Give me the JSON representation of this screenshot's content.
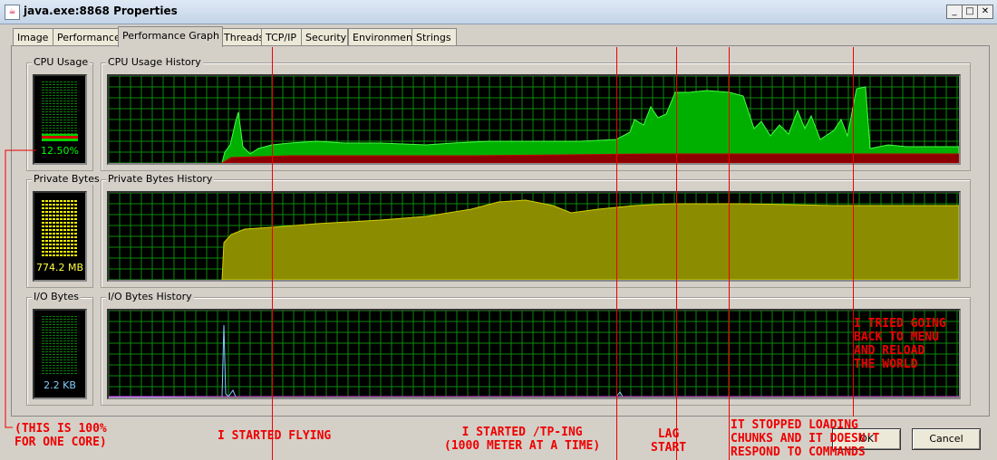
{
  "window": {
    "title": "java.exe:8868 Properties",
    "minimize": "_",
    "maximize": "□",
    "close": "✕",
    "icon": "java-icon"
  },
  "tabs": [
    "Image",
    "Performance",
    "Performance Graph",
    "Threads",
    "TCP/IP",
    "Security",
    "Environment",
    "Strings"
  ],
  "active_tab": "Performance Graph",
  "groups": {
    "cpu_usage": {
      "label": "CPU Usage",
      "value": "12.50%",
      "level": 0.125
    },
    "cpu_history": {
      "label": "CPU Usage History"
    },
    "private_bytes": {
      "label": "Private Bytes",
      "value": "774.2 MB",
      "level": 0.93
    },
    "private_history": {
      "label": "Private Bytes History"
    },
    "io_bytes": {
      "label": "I/O Bytes",
      "value": "2.2  KB"
    },
    "io_history": {
      "label": "I/O Bytes History"
    }
  },
  "colors": {
    "grid": "#0a8a0a",
    "cpu_fill": "#00b000",
    "cpu_kernel": "#8b0000",
    "private_fill": "#8c8c00",
    "io_line": "#7fd0ff",
    "annotation": "#ee0000"
  },
  "annotations": {
    "one_core": "(this is 100%\nfor one core)",
    "flying": "I started flying",
    "tp": "I started /tp-ing\n(1000 meter at a time)",
    "lag": "Lag\nstart",
    "stopped": "it stopped loading\nchunks and it doesn't\nrespond to commands",
    "menu": "I tried going\nback to menu\nand reload\nthe world"
  },
  "buttons": {
    "ok": "OK",
    "cancel": "Cancel"
  }
}
